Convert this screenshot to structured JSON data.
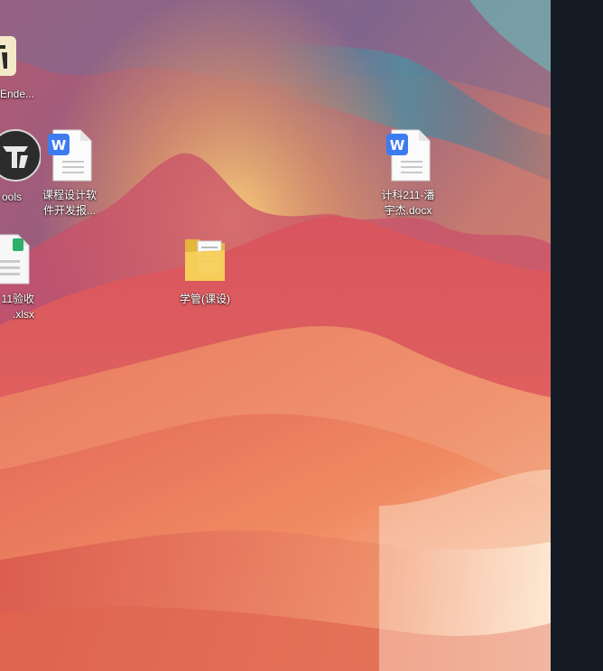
{
  "desktop": {
    "icons": [
      {
        "label": "Ende...",
        "icon": "app-icon-partial"
      },
      {
        "label": "ools",
        "icon": "tools-app-icon"
      },
      {
        "label": "11验收\n.xlsx",
        "icon": "excel-file-icon"
      },
      {
        "label": "课程设计软\n件开发报...",
        "icon": "word-document-icon"
      },
      {
        "label": "学管(课设)",
        "icon": "folder-icon"
      },
      {
        "label": "计科211-潘\n宇杰.docx",
        "icon": "word-document-icon"
      }
    ]
  },
  "colors": {
    "side_panel": "#141b25",
    "word_blue": "#3d7cf0",
    "folder_yellow": "#f5c84a"
  }
}
